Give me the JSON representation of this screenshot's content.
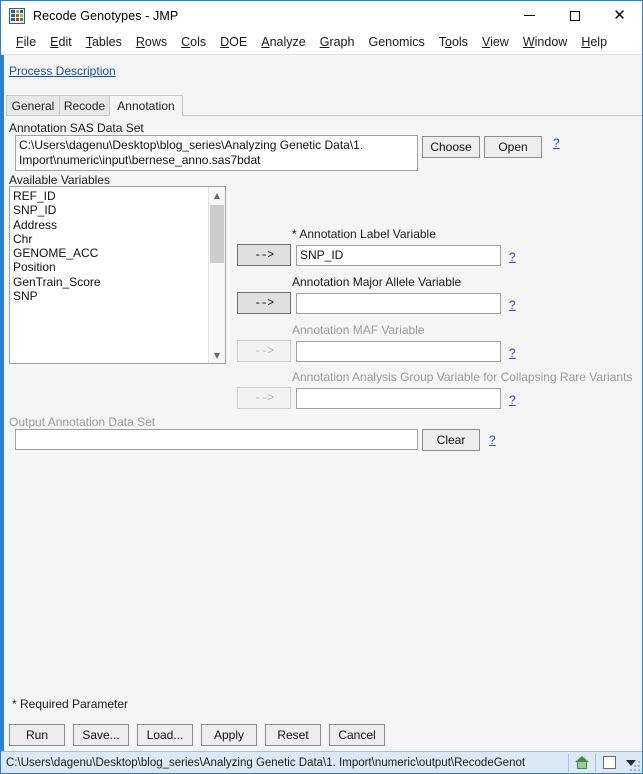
{
  "window": {
    "title": "Recode Genotypes - JMP",
    "icon": "jmp-app-icon",
    "controls": {
      "minimize": "minimize-icon",
      "maximize": "maximize-icon",
      "close": "close-icon"
    }
  },
  "menubar": {
    "items": [
      {
        "label": "File",
        "accel": "F"
      },
      {
        "label": "Edit",
        "accel": "E"
      },
      {
        "label": "Tables",
        "accel": "T"
      },
      {
        "label": "Rows",
        "accel": "R"
      },
      {
        "label": "Cols",
        "accel": "C"
      },
      {
        "label": "DOE",
        "accel": "D"
      },
      {
        "label": "Analyze",
        "accel": "A"
      },
      {
        "label": "Graph",
        "accel": "G"
      },
      {
        "label": "Genomics",
        "accel": ""
      },
      {
        "label": "Tools",
        "accel": "o"
      },
      {
        "label": "View",
        "accel": "V"
      },
      {
        "label": "Window",
        "accel": "W"
      },
      {
        "label": "Help",
        "accel": "H"
      }
    ]
  },
  "process_description": {
    "label": "Process Description"
  },
  "tabs": [
    {
      "label": "General",
      "active": false
    },
    {
      "label": "Recode",
      "active": false
    },
    {
      "label": "Annotation",
      "active": true
    }
  ],
  "annotation_tab": {
    "data_set": {
      "label": "Annotation SAS Data Set",
      "value": "C:\\Users\\dagenu\\Desktop\\blog_series\\Analyzing Genetic Data\\1. Import\\numeric\\input\\bernese_anno.sas7bdat",
      "choose_button": "Choose",
      "open_button": "Open",
      "help": "?"
    },
    "available_variables": {
      "label": "Available Variables",
      "items": [
        "REF_ID",
        "SNP_ID",
        "Address",
        "Chr",
        "GENOME_ACC",
        "Position",
        "GenTrain_Score",
        "SNP"
      ],
      "scroll_up": "scroll-up-icon",
      "scroll_down": "scroll-down-icon"
    },
    "assignments": [
      {
        "label": "* Annotation Label Variable",
        "value": "SNP_ID",
        "arrow": "-->",
        "enabled": true,
        "help": "?"
      },
      {
        "label": "Annotation Major Allele Variable",
        "value": "",
        "arrow": "-->",
        "enabled": true,
        "help": "?"
      },
      {
        "label": "Annotation MAF Variable",
        "value": "",
        "arrow": "-->",
        "enabled": false,
        "help": "?"
      },
      {
        "label": "Annotation Analysis Group Variable for Collapsing Rare Variants",
        "value": "",
        "arrow": "-->",
        "enabled": false,
        "help": "?"
      }
    ],
    "output": {
      "label": "Output Annotation Data Set",
      "value": "",
      "clear_button": "Clear",
      "help": "?"
    }
  },
  "footer": {
    "required_note": "* Required Parameter",
    "buttons": [
      {
        "label": "Run"
      },
      {
        "label": "Save..."
      },
      {
        "label": "Load..."
      },
      {
        "label": "Apply"
      },
      {
        "label": "Reset"
      },
      {
        "label": "Cancel"
      }
    ]
  },
  "statusbar": {
    "path": "C:\\Users\\dagenu\\Desktop\\blog_series\\Analyzing Genetic Data\\1. Import\\numeric\\output\\RecodeGenot",
    "home_icon": "home-icon",
    "window_icon": "window-icon",
    "dropdown_icon": "chevron-down-icon"
  },
  "colors": {
    "window_border": "#2a7fd4",
    "content_bg": "#f5f5f5",
    "statusbar_bg": "#dbe9f7",
    "link": "#1a4fa3",
    "help_link": "#2b4fb5",
    "disabled_text": "#9a9a9a"
  }
}
